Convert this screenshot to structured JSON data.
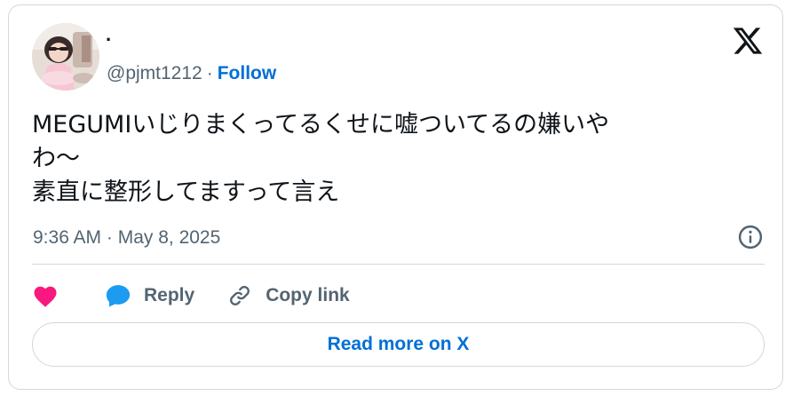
{
  "author": {
    "display_name": "·",
    "handle": "@pjmt1212",
    "separator": "·",
    "follow_label": "Follow"
  },
  "tweet": {
    "text": "MEGUMIいじりまくってるくせに嘘ついてるの嫌いや\nわ〜\n素直に整形してますって言え",
    "timestamp": "9:36 AM · May 8, 2025"
  },
  "actions": {
    "like_icon": "heart-icon",
    "reply_label": "Reply",
    "copy_link_label": "Copy link"
  },
  "footer": {
    "read_more_label": "Read more on X"
  },
  "colors": {
    "like": "#f91880",
    "reply_icon": "#1d9bf0",
    "link": "#006fd6",
    "muted": "#536471",
    "text": "#0f1419",
    "border": "#cfd9de"
  }
}
